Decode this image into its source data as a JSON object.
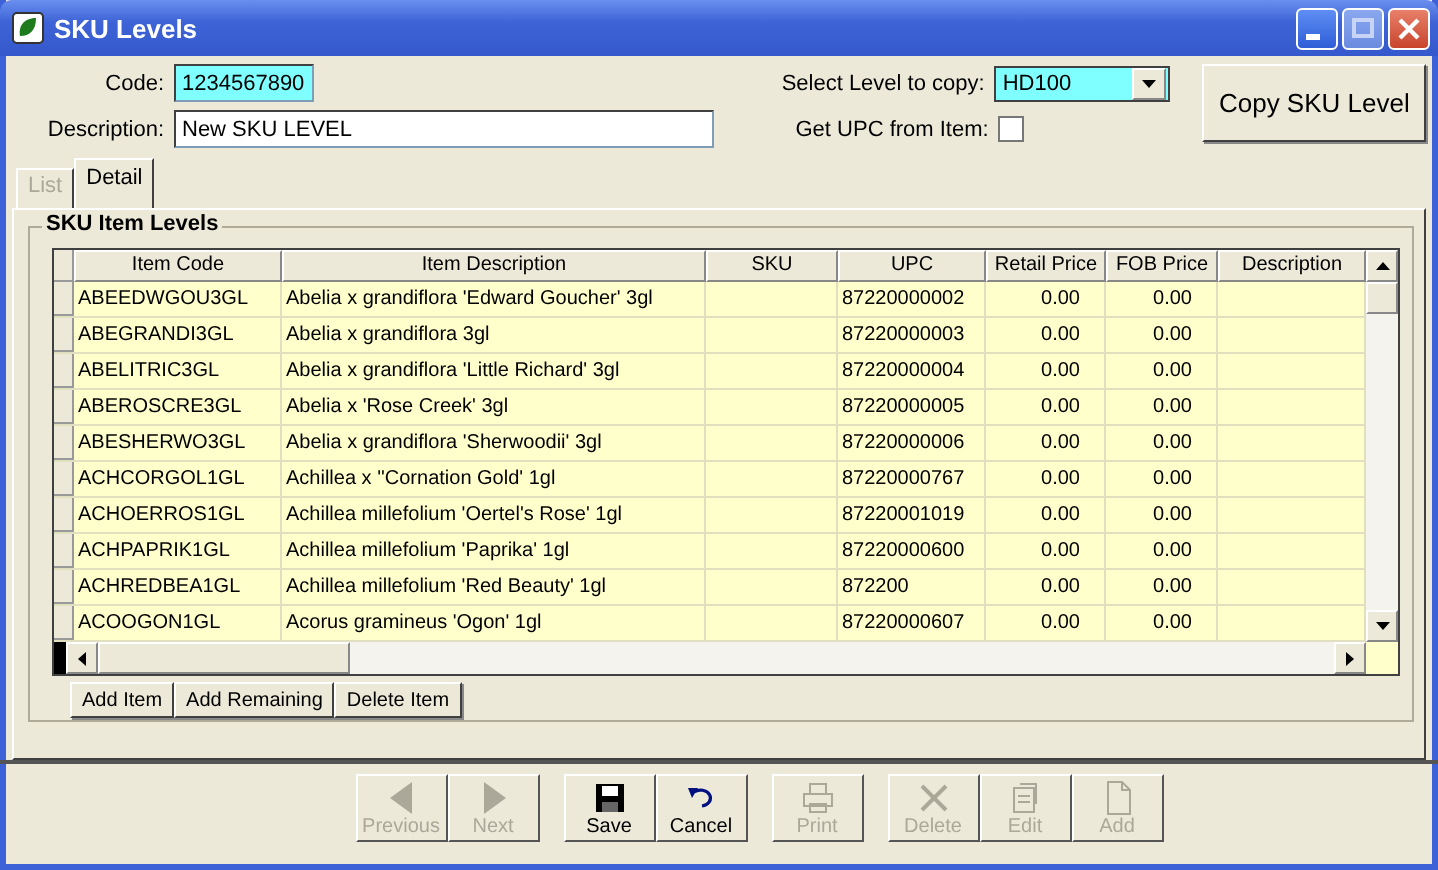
{
  "window": {
    "title": "SKU Levels"
  },
  "form": {
    "code_label": "Code:",
    "code": "1234567890",
    "description_label": "Description:",
    "description": "New SKU LEVEL",
    "level_label": "Select Level to copy:",
    "level": "HD100",
    "upc_label": "Get UPC from Item:",
    "upc_checked": false,
    "copy_button": "Copy SKU Level"
  },
  "tabs": [
    {
      "label": "List",
      "selected": false,
      "disabled": true
    },
    {
      "label": "Detail",
      "selected": true,
      "disabled": false
    }
  ],
  "group": {
    "title": "SKU Item Levels"
  },
  "table": {
    "columns": [
      "Item Code",
      "Item Description",
      "SKU",
      "UPC",
      "Retail Price",
      "FOB Price",
      "Description"
    ],
    "rows": [
      [
        "ABEEDWGOU3GL",
        "Abelia x grandiflora 'Edward Goucher' 3gl",
        "",
        "87220000002",
        "0.00",
        "0.00",
        ""
      ],
      [
        "ABEGRANDI3GL",
        "Abelia x grandiflora 3gl",
        "",
        "87220000003",
        "0.00",
        "0.00",
        ""
      ],
      [
        "ABELITRIC3GL",
        "Abelia x grandiflora 'Little Richard' 3gl",
        "",
        "87220000004",
        "0.00",
        "0.00",
        ""
      ],
      [
        "ABEROSCRE3GL",
        "Abelia x 'Rose Creek' 3gl",
        "",
        "87220000005",
        "0.00",
        "0.00",
        ""
      ],
      [
        "ABESHERWO3GL",
        "Abelia x grandiflora 'Sherwoodii' 3gl",
        "",
        "87220000006",
        "0.00",
        "0.00",
        ""
      ],
      [
        "ACHCORGOL1GL",
        "Achillea x ''Cornation Gold' 1gl",
        "",
        "87220000767",
        "0.00",
        "0.00",
        ""
      ],
      [
        "ACHOERROS1GL",
        "Achillea millefolium 'Oertel's Rose' 1gl",
        "",
        "87220001019",
        "0.00",
        "0.00",
        ""
      ],
      [
        "ACHPAPRIK1GL",
        "Achillea millefolium 'Paprika' 1gl",
        "",
        "87220000600",
        "0.00",
        "0.00",
        ""
      ],
      [
        "ACHREDBEA1GL",
        "Achillea millefolium 'Red Beauty' 1gl",
        "",
        "872200",
        "0.00",
        "0.00",
        ""
      ],
      [
        "ACOOGON1GL",
        "Acorus gramineus 'Ogon' 1gl",
        "",
        "87220000607",
        "0.00",
        "0.00",
        ""
      ]
    ]
  },
  "grid_buttons": [
    "Add Item",
    "Add Remaining",
    "Delete Item"
  ],
  "toolbar": [
    {
      "kind": "previous",
      "label": "Previous",
      "disabled": true
    },
    {
      "kind": "next",
      "label": "Next",
      "disabled": true
    },
    {
      "kind": "save",
      "label": "Save",
      "disabled": false
    },
    {
      "kind": "cancel",
      "label": "Cancel",
      "disabled": false
    },
    {
      "kind": "print",
      "label": "Print",
      "disabled": true
    },
    {
      "kind": "delete",
      "label": "Delete",
      "disabled": true
    },
    {
      "kind": "edit",
      "label": "Edit",
      "disabled": true
    },
    {
      "kind": "add",
      "label": "Add",
      "disabled": true
    }
  ]
}
